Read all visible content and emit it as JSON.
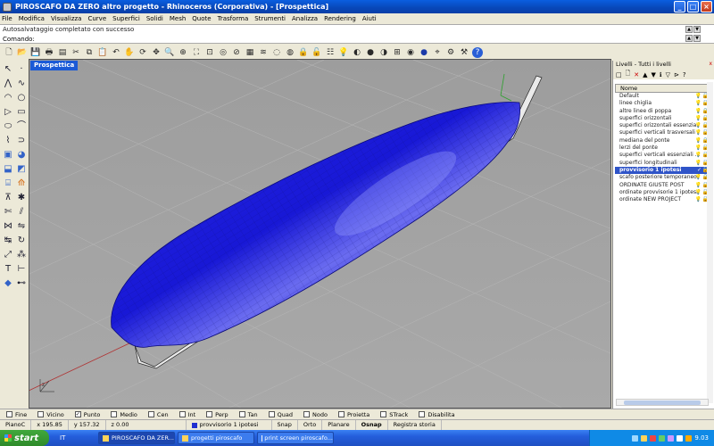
{
  "window": {
    "title": "PIROSCAFO DA ZERO altro progetto - Rhinoceros (Corporativa) - [Prospettica]",
    "minimize": "_",
    "maximize": "□",
    "close": "×"
  },
  "menu": [
    "File",
    "Modifica",
    "Visualizza",
    "Curve",
    "Superfici",
    "Solidi",
    "Mesh",
    "Quote",
    "Trasforma",
    "Strumenti",
    "Analizza",
    "Rendering",
    "Aiuti"
  ],
  "command": {
    "history": "Autosalvataggio completato con successo",
    "prompt": "Comando:"
  },
  "toolbar_icons": [
    "new-file",
    "open",
    "save",
    "print",
    "import",
    "cut",
    "copy",
    "paste",
    "undo",
    "pan",
    "rotate-view",
    "zoom",
    "zoom-window",
    "zoom-extents",
    "zoom-selected",
    "zoom-target",
    "zoom-dynamic",
    "grid",
    "layers",
    "hide",
    "show",
    "lock",
    "unlock",
    "properties",
    "render-preview",
    "shaded",
    "render",
    "materials",
    "wireframe",
    "ghosted",
    "xray",
    "sphere",
    "osnap",
    "options",
    "help"
  ],
  "left_icons": [
    "select",
    "point",
    "polyline",
    "curve",
    "arc",
    "circle",
    "polygon",
    "rectangle",
    "ellipse",
    "fillet",
    "free-curve",
    "offset",
    "box",
    "sphere",
    "extrude",
    "surface",
    "cylinder",
    "loft",
    "boolean",
    "explode",
    "trim",
    "split",
    "join",
    "mirror",
    "move",
    "rotate",
    "scale",
    "array",
    "text",
    "dimension",
    "analyze",
    "render"
  ],
  "viewport": {
    "label": "Prospettica",
    "axis_label": "z"
  },
  "layers_panel": {
    "title": "Livelli - Tutti i livelli",
    "close": "x",
    "tools": [
      "□",
      "🗋",
      "✕",
      "▲",
      "▼",
      "ℹ",
      "▽",
      "⊳",
      "?"
    ],
    "column": "Nome",
    "layers": [
      "Default",
      "linee chiglia",
      "altre linee di poppa",
      "superfici orizzontali",
      "superfici orizzontali essenziali",
      "superfici verticali trasversali",
      "mediana del ponte",
      "lerzi del ponte",
      "superfici verticali essenziali ...",
      "superfici longitudinali",
      "provvisorio 1 ipotesi",
      "scafo posteriore temporaneo",
      "ORDINATE GIUSTE POST",
      "ordinate provvisorie 1 ipotesi",
      "ordinate NEW PROJECT"
    ],
    "selected_index": 10
  },
  "osnap": [
    {
      "label": "Fine",
      "checked": false
    },
    {
      "label": "Vicino",
      "checked": false
    },
    {
      "label": "Punto",
      "checked": true
    },
    {
      "label": "Medio",
      "checked": false
    },
    {
      "label": "Cen",
      "checked": false
    },
    {
      "label": "Int",
      "checked": false
    },
    {
      "label": "Perp",
      "checked": false
    },
    {
      "label": "Tan",
      "checked": false
    },
    {
      "label": "Quad",
      "checked": false
    },
    {
      "label": "Nodo",
      "checked": false
    },
    {
      "label": "Proietta",
      "checked": false
    },
    {
      "label": "STrack",
      "checked": false
    },
    {
      "label": "Disabilita",
      "checked": false
    }
  ],
  "status": {
    "cplane": "PianoC",
    "x": "x 195.85",
    "y": "y 157.32",
    "z": "z 0.00",
    "layer": "provvisorio 1 ipotesi",
    "snap": "Snap",
    "orto": "Orto",
    "planare": "Planare",
    "osnap": "Osnap",
    "history": "Registra storia"
  },
  "taskbar": {
    "start": "start",
    "language": "IT",
    "tasks": [
      "PIROSCAFO DA ZER...",
      "progetti piroscafo",
      "print screen piroscafo..."
    ],
    "time": "9.03"
  },
  "colors": {
    "hull": "#1616d8",
    "viewport_bg": "#a4a4a4",
    "selected_layer": "#2f54c8"
  }
}
